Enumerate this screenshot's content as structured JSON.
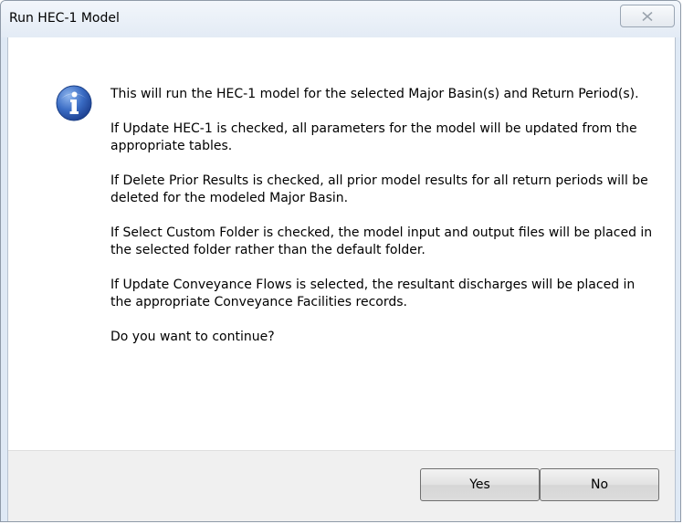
{
  "window": {
    "title": "Run HEC-1 Model"
  },
  "icons": {
    "close": "close-icon",
    "info": "info-icon"
  },
  "message": {
    "paragraphs": [
      "This will run the HEC-1 model for the selected Major Basin(s) and Return Period(s).",
      "If Update HEC-1 is checked, all parameters for the model will be updated from the appropriate tables.",
      "If Delete Prior Results is checked, all prior model results for all return periods will be deleted for the modeled Major Basin.",
      "If Select Custom Folder is checked, the model input and output files will be placed in the selected folder rather than the default folder.",
      "If Update Conveyance Flows is selected, the resultant discharges will be placed in the appropriate Conveyance Facilities records.",
      "Do you want to continue?"
    ]
  },
  "buttons": {
    "yes": "Yes",
    "no": "No"
  },
  "colors": {
    "info_icon": "#2a5bb5",
    "footer": "#f0f0f0"
  }
}
